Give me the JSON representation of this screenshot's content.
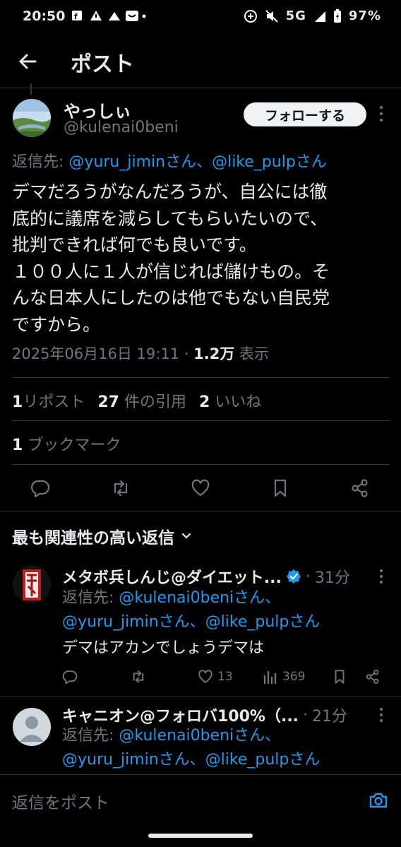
{
  "status_bar": {
    "time": "20:50",
    "network": "5G",
    "battery": "97%"
  },
  "header": {
    "title": "ポスト"
  },
  "tweet": {
    "display_name": "やっしぃ",
    "handle": "@kulenai0beni",
    "follow_label": "フォローする",
    "reply_prefix": "返信先:",
    "reply_targets": "@yuru_jiminさん、@like_pulpさん",
    "text": "デマだろうがなんだろうが、自公には徹\n底的に議席を減らしてもらいたいので、\n批判できれば何でも良いです。\n１００人に１人が信じれば儲けもの。そ\nんな日本人にしたのは他でもない自民党\nですから。",
    "timestamp": "2025年06月16日 19:11",
    "views_count": "1.2万",
    "views_label": "表示",
    "reposts_count": "1",
    "reposts_label": "リポスト",
    "quotes_count": "27",
    "quotes_label": "件の引用",
    "likes_count": "2",
    "likes_label": "いいね",
    "bookmarks_count": "1",
    "bookmarks_label": "ブックマーク"
  },
  "replies_section": {
    "sort_label": "最も関連性の高い返信"
  },
  "replies": [
    {
      "display_name": "メタボ兵しんじ@ダイエット...",
      "verified": true,
      "time": "31分",
      "reply_prefix": "返信先:",
      "reply_line1": "@kulenai0beniさん、",
      "reply_line2": "@yuru_jiminさん、@like_pulpさん",
      "text": "デマはアカンでしょうデマは",
      "likes": "13",
      "views": "369"
    },
    {
      "display_name": "キャニオン@フォロバ100%（...",
      "time": "21分",
      "reply_prefix": "返信先:",
      "reply_line1": "@kulenai0beniさん、",
      "reply_line2": "@yuru_jiminさん、@like_pulpさん"
    }
  ],
  "compose": {
    "placeholder": "返信をポスト"
  },
  "colors": {
    "background": "#000000",
    "text": "#e7e9ea",
    "muted": "#71767b",
    "link": "#1d9bf0",
    "divider": "#2f3336"
  }
}
